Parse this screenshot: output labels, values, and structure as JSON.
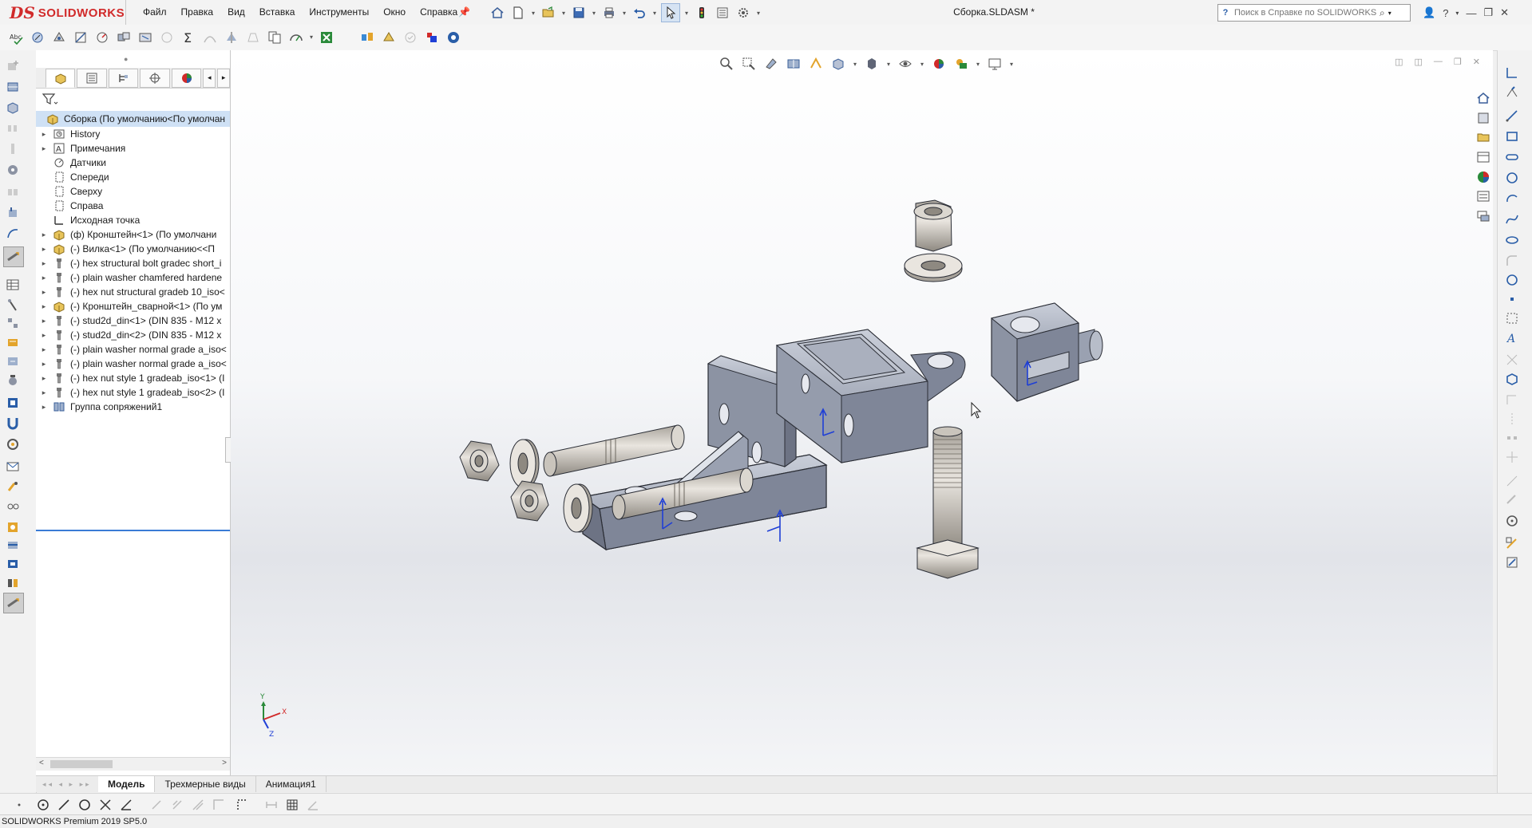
{
  "app": {
    "logo_prefix": "DS",
    "logo_name": "SOLIDWORKS",
    "document_title": "Сборка.SLDASM *"
  },
  "menu": [
    "Файл",
    "Правка",
    "Вид",
    "Вставка",
    "Инструменты",
    "Окно",
    "Справка"
  ],
  "search": {
    "placeholder": "Поиск в Справке по SOLIDWORKS"
  },
  "feature_tree": {
    "root": "Сборка  (По умолчанию<По умолчан",
    "items": [
      {
        "label": "History",
        "icon": "history-folder-icon",
        "expand": true
      },
      {
        "label": "Примечания",
        "icon": "annotations-icon",
        "expand": true
      },
      {
        "label": "Датчики",
        "icon": "sensors-icon",
        "expand": false
      },
      {
        "label": "Спереди",
        "icon": "plane-icon",
        "expand": false
      },
      {
        "label": "Сверху",
        "icon": "plane-icon",
        "expand": false
      },
      {
        "label": "Справа",
        "icon": "plane-icon",
        "expand": false
      },
      {
        "label": "Исходная точка",
        "icon": "origin-icon",
        "expand": false
      },
      {
        "label": "(ф) Кронштейн<1> (По умолчани",
        "icon": "subassembly-icon",
        "expand": true
      },
      {
        "label": "(-) Вилка<1> (По умолчанию<<П",
        "icon": "subassembly-icon",
        "expand": true
      },
      {
        "label": "(-) hex structural bolt gradec short_i",
        "icon": "part-icon",
        "expand": true
      },
      {
        "label": "(-) plain washer chamfered hardene",
        "icon": "part-icon",
        "expand": true
      },
      {
        "label": "(-) hex nut structural gradeb 10_iso<",
        "icon": "part-icon",
        "expand": true
      },
      {
        "label": "(-) Кронштейн_сварной<1> (По ум",
        "icon": "subassembly-icon",
        "expand": true
      },
      {
        "label": "(-) stud2d_din<1> (DIN 835 - M12  x",
        "icon": "part-icon",
        "expand": true
      },
      {
        "label": "(-) stud2d_din<2> (DIN 835 - M12  x",
        "icon": "part-icon",
        "expand": true
      },
      {
        "label": "(-) plain washer normal grade a_iso<",
        "icon": "part-icon",
        "expand": true
      },
      {
        "label": "(-) plain washer normal grade a_iso<",
        "icon": "part-icon",
        "expand": true
      },
      {
        "label": "(-) hex nut style 1 gradeab_iso<1> (I",
        "icon": "part-icon",
        "expand": true
      },
      {
        "label": "(-) hex nut style 1 gradeab_iso<2> (I",
        "icon": "part-icon",
        "expand": true
      },
      {
        "label": "Группа сопряжений1",
        "icon": "mates-icon",
        "expand": true
      }
    ]
  },
  "bottom_tabs": [
    {
      "label": "Модель",
      "active": true
    },
    {
      "label": "Трехмерные виды",
      "active": false
    },
    {
      "label": "Анимация1",
      "active": false
    }
  ],
  "triad": {
    "x": "X",
    "y": "Y",
    "z": "Z"
  },
  "status": "SOLIDWORKS Premium 2019 SP5.0",
  "colors": {
    "accent": "#3a7bd5",
    "brand": "#d12a2a",
    "part": "#8c93a3",
    "part_light": "#b5bbc8",
    "part_dark": "#5f6576",
    "mate_blue": "#1f3fd6"
  }
}
